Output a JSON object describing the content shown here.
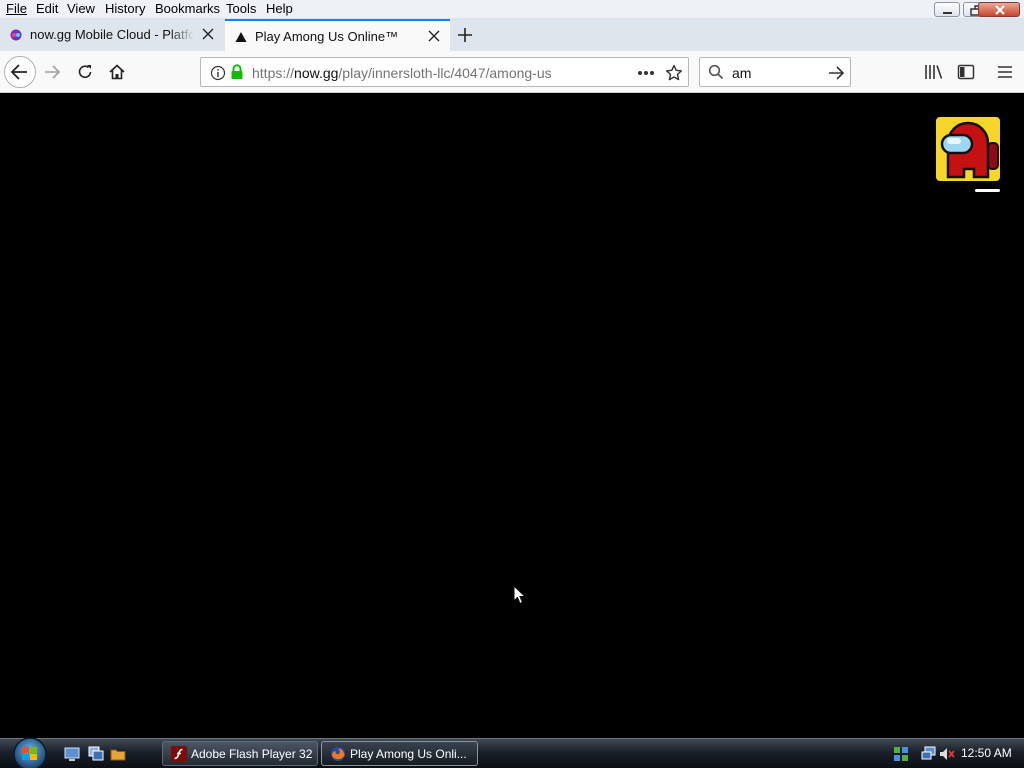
{
  "menubar": {
    "items": [
      {
        "label": "File",
        "underline": "F"
      },
      {
        "label": "Edit",
        "underline": "E"
      },
      {
        "label": "View",
        "underline": "V"
      },
      {
        "label": "History",
        "underline": "s"
      },
      {
        "label": "Bookmarks",
        "underline": "B"
      },
      {
        "label": "Tools",
        "underline": "T"
      },
      {
        "label": "Help",
        "underline": "H"
      }
    ]
  },
  "tabs": [
    {
      "title": "now.gg Mobile Cloud - Platform",
      "active": false,
      "favicon": "nowgg-icon"
    },
    {
      "title": "Play Among Us Online™",
      "active": true,
      "favicon": "among-us-triangle-icon"
    }
  ],
  "navbar": {
    "url_prefix": "https://",
    "url_host": "now.gg",
    "url_path": "/play/innersloth-llc/4047/among-us",
    "search_value": "am"
  },
  "taskbar": {
    "buttons": [
      {
        "label": "Adobe Flash Player 32",
        "icon": "flash-player-icon",
        "active": false
      },
      {
        "label": "Play Among Us Onli...",
        "icon": "firefox-icon",
        "active": true
      }
    ],
    "clock": "12:50 AM"
  },
  "colors": {
    "tab_accent": "#0a84ff",
    "lock_green": "#12bc00",
    "game_icon_bg": "#f5d62b",
    "crewmate_red": "#c51111"
  }
}
